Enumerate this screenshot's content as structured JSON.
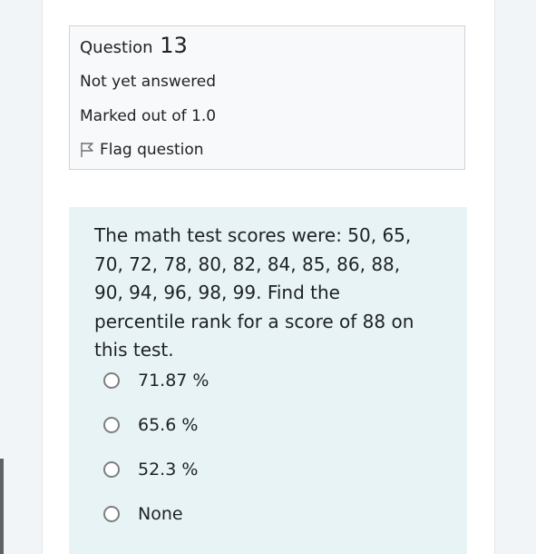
{
  "question": {
    "label": "Question",
    "number": "13",
    "state": "Not yet answered",
    "grade": "Marked out of 1.0",
    "flag_label": "Flag question",
    "flag_icon": "flag-icon"
  },
  "content": {
    "text": "The math test scores were: 50, 65, 70, 72, 78, 80, 82, 84, 85, 86, 88, 90, 94, 96, 98, 99. Find the percentile rank for a score of 88 on this test.",
    "options": [
      {
        "label": "71.87 %",
        "selected": false
      },
      {
        "label": "65.6 %",
        "selected": false
      },
      {
        "label": "52.3 %",
        "selected": false
      },
      {
        "label": "None",
        "selected": false
      }
    ]
  },
  "colors": {
    "page_background": "#f2f5f8",
    "info_background": "#f8f9fa",
    "question_background": "#e8f3f5",
    "text": "#1d2125",
    "radio_border": "#7b7f84"
  }
}
